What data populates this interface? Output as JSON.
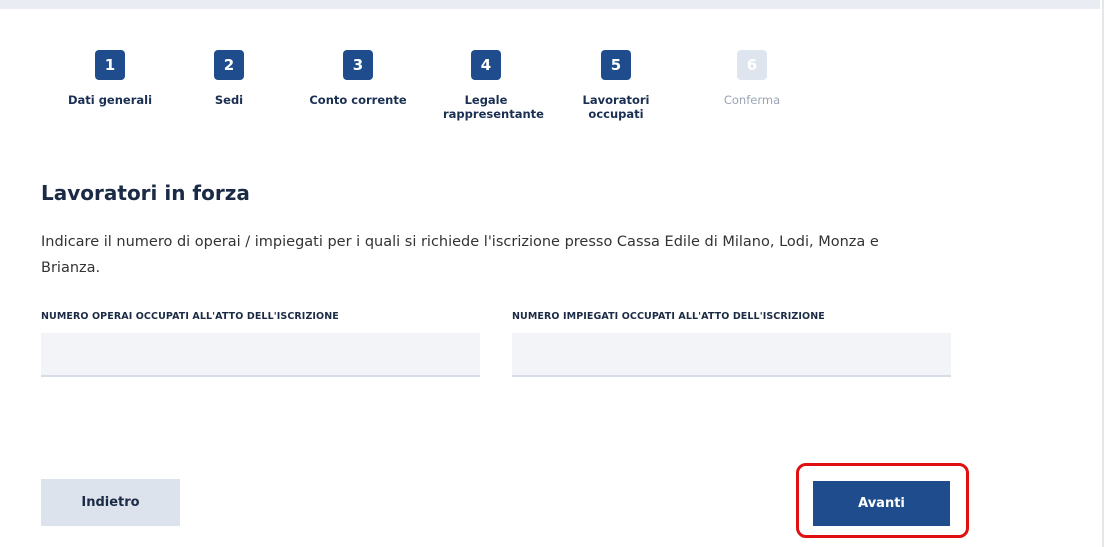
{
  "stepper": {
    "steps": [
      {
        "number": "1",
        "label": "Dati generali"
      },
      {
        "number": "2",
        "label": "Sedi"
      },
      {
        "number": "3",
        "label": "Conto corrente"
      },
      {
        "number": "4",
        "label": "Legale rappresentante"
      },
      {
        "number": "5",
        "label": "Lavoratori occupati"
      },
      {
        "number": "6",
        "label": "Conferma"
      }
    ],
    "current_step": 5
  },
  "section": {
    "title": "Lavoratori in forza",
    "description": "Indicare il numero di operai / impiegati per i quali si richiede l'iscrizione presso Cassa Edile di Milano, Lodi, Monza e Brianza."
  },
  "form": {
    "operai_label": "NUMERO OPERAI OCCUPATI ALL'ATTO DELL'ISCRIZIONE",
    "operai_value": "",
    "impiegati_label": "NUMERO IMPIEGATI OCCUPATI ALL'ATTO DELL'ISCRIZIONE",
    "impiegati_value": ""
  },
  "actions": {
    "back_label": "Indietro",
    "next_label": "Avanti"
  },
  "colors": {
    "primary": "#1e4c8c",
    "disabled": "#dfe5ee",
    "highlight": "#e01010"
  }
}
